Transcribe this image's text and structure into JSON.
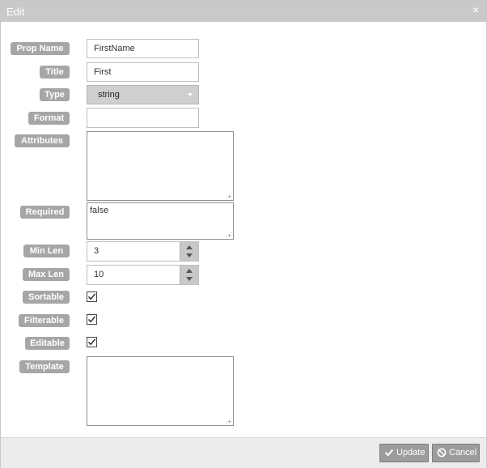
{
  "dialog": {
    "title": "Edit",
    "close_glyph": "×",
    "close_icon": "close-icon"
  },
  "form": {
    "prop_name": {
      "label": "Prop Name",
      "value": "FirstName"
    },
    "title": {
      "label": "Title",
      "value": "First"
    },
    "type": {
      "label": "Type",
      "value": "string"
    },
    "format": {
      "label": "Format",
      "value": ""
    },
    "attributes": {
      "label": "Attributes",
      "value": ""
    },
    "required": {
      "label": "Required",
      "value": "false"
    },
    "min_len": {
      "label": "Min Len",
      "value": "3"
    },
    "max_len": {
      "label": "Max Len",
      "value": "10"
    },
    "sortable": {
      "label": "Sortable",
      "checked": true
    },
    "filterable": {
      "label": "Filterable",
      "checked": true
    },
    "editable": {
      "label": "Editable",
      "checked": true
    },
    "template": {
      "label": "Template",
      "value": ""
    }
  },
  "footer": {
    "update_label": "Update",
    "update_icon": "check-icon",
    "cancel_label": "Cancel",
    "cancel_icon": "cancel-icon"
  },
  "colors": {
    "titlebar": "#c9c9c9",
    "label_bg": "#a6a6a6",
    "button_bg": "#9c9c9c",
    "footer_bg": "#ececec"
  }
}
